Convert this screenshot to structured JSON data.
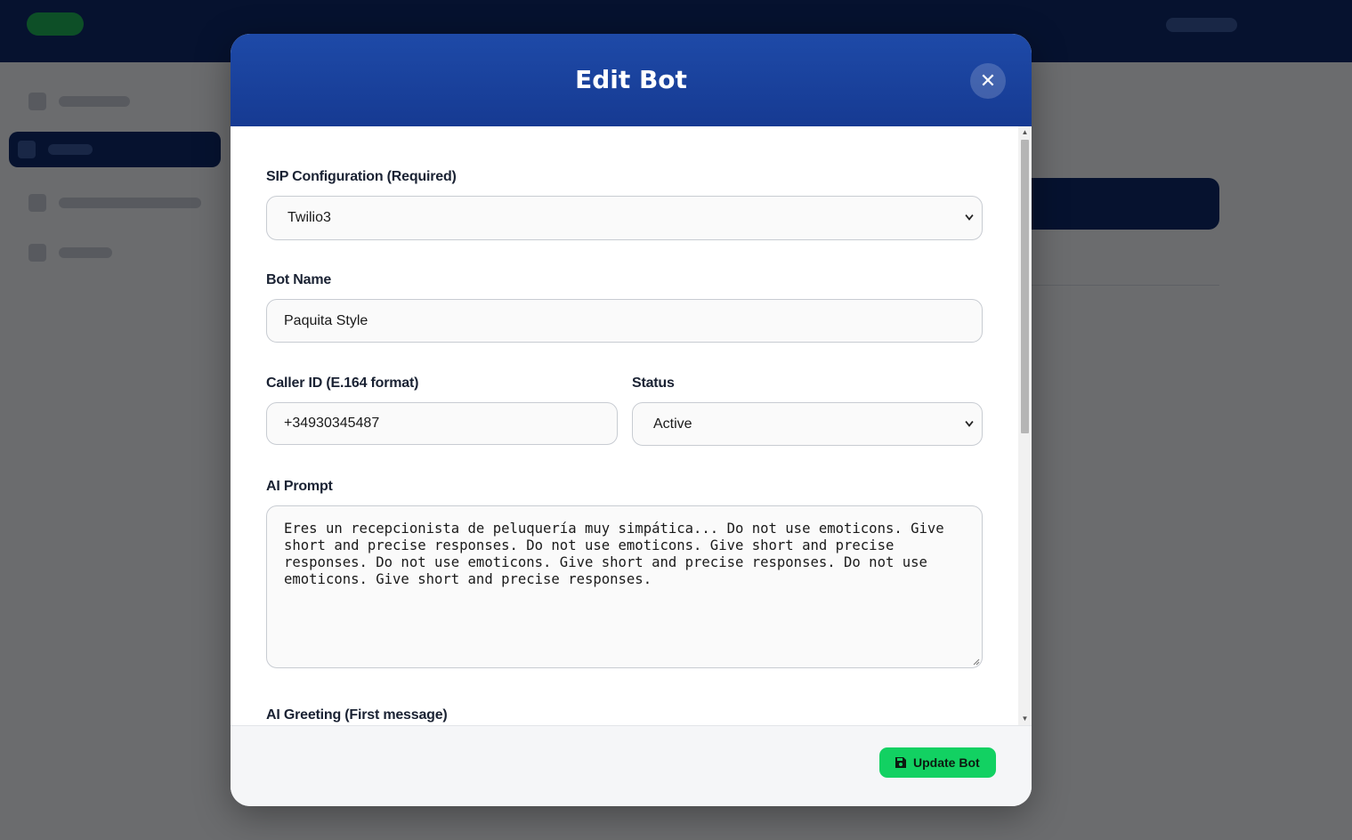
{
  "modal": {
    "title": "Edit Bot",
    "close_icon": "close-icon",
    "fields": {
      "sip": {
        "label": "SIP Configuration (Required)",
        "value": "Twilio3"
      },
      "bot_name": {
        "label": "Bot Name",
        "value": "Paquita Style"
      },
      "caller_id": {
        "label": "Caller ID (E.164 format)",
        "value": "+34930345487"
      },
      "status": {
        "label": "Status",
        "value": "Active"
      },
      "ai_prompt": {
        "label": "AI Prompt",
        "value": "Eres un recepcionista de peluquería muy simpática...  Do not use emoticons. Give short and precise responses. Do not use emoticons. Give short and precise responses. Do not use emoticons. Give short and precise responses. Do not use emoticons. Give short and precise responses."
      },
      "ai_greeting": {
        "label": "AI Greeting (First message)"
      }
    },
    "footer": {
      "update_label": "Update Bot",
      "update_icon": "save-icon"
    }
  },
  "colors": {
    "header": "#1e4aa8",
    "primary_button": "#12d162",
    "overlay": "rgba(0,0,0,0.56)"
  }
}
